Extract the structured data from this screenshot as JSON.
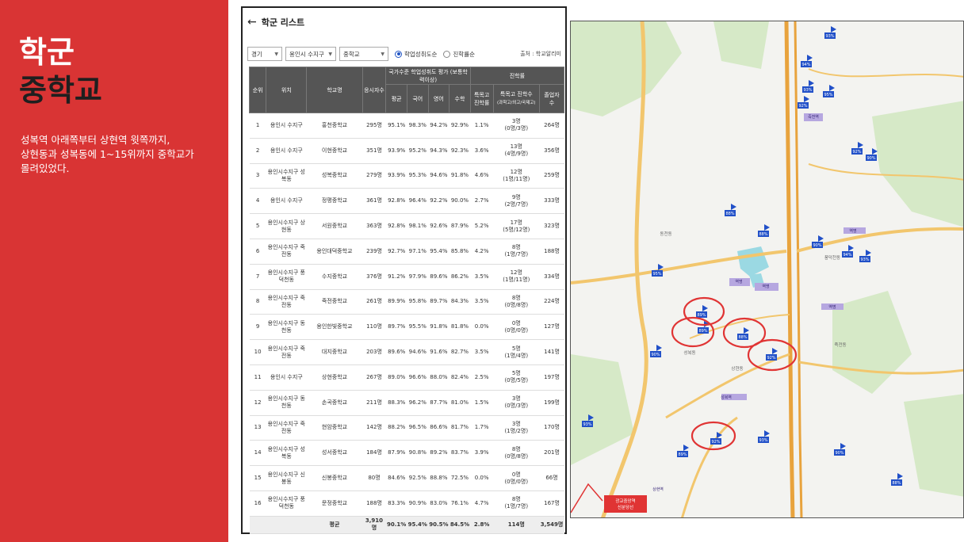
{
  "slide": {
    "title_line1": "학군",
    "title_line2": "중학교",
    "description": "성복역 아래쪽부터 상현역 윗쪽까지,\n상현동과 성복동에 1~15위까지 중학교가\n몰려있었다."
  },
  "list": {
    "header_title": "학군 리스트",
    "filters": {
      "region": "경기",
      "district": "용인시 수지구",
      "school_level": "중학교",
      "sort_option_1": "학업성취도순",
      "sort_option_2": "진학률순",
      "selected_sort": "학업성취도순"
    },
    "source": "출처 : 학교알리미",
    "columns": {
      "rank": "순위",
      "location": "위치",
      "school": "학교명",
      "test_takers": "응시자수",
      "achievement_group": "국가수준 학업성취도 평가 (보통학력이상)",
      "avg": "평균",
      "korean": "국어",
      "english": "영어",
      "math": "수학",
      "advancement_group": "진학률",
      "special_rate": "특목고 진학률",
      "special_count": "특목고 진학수",
      "special_count_sub": "(과학고/외고/국제고)",
      "graduates": "졸업자 수"
    },
    "rows": [
      {
        "rank": "1",
        "location": "용인시 수지구",
        "school": "홍천중학교",
        "takers": "295명",
        "avg": "95.1%",
        "kor": "98.3%",
        "eng": "94.2%",
        "math": "92.9%",
        "rate": "1.1%",
        "count": "3명",
        "count_sub": "(0명/3명)",
        "grads": "264명"
      },
      {
        "rank": "2",
        "location": "용인시 수지구",
        "school": "이현중학교",
        "takers": "351명",
        "avg": "93.9%",
        "kor": "95.2%",
        "eng": "94.3%",
        "math": "92.3%",
        "rate": "3.6%",
        "count": "13명",
        "count_sub": "(4명/9명)",
        "grads": "356명"
      },
      {
        "rank": "3",
        "location": "용인시수지구 성복동",
        "school": "성복중학교",
        "takers": "279명",
        "avg": "93.9%",
        "kor": "95.3%",
        "eng": "94.6%",
        "math": "91.8%",
        "rate": "4.6%",
        "count": "12명",
        "count_sub": "(1명/11명)",
        "grads": "259명"
      },
      {
        "rank": "4",
        "location": "용인시 수지구",
        "school": "정평중학교",
        "takers": "361명",
        "avg": "92.8%",
        "kor": "96.4%",
        "eng": "92.2%",
        "math": "90.0%",
        "rate": "2.7%",
        "count": "9명",
        "count_sub": "(2명/7명)",
        "grads": "333명"
      },
      {
        "rank": "5",
        "location": "용인시수지구 상현동",
        "school": "서원중학교",
        "takers": "363명",
        "avg": "92.8%",
        "kor": "98.1%",
        "eng": "92.6%",
        "math": "87.9%",
        "rate": "5.2%",
        "count": "17명",
        "count_sub": "(5명/12명)",
        "grads": "323명"
      },
      {
        "rank": "6",
        "location": "용인시수지구 죽전동",
        "school": "용인대덕중학교",
        "takers": "239명",
        "avg": "92.7%",
        "kor": "97.1%",
        "eng": "95.4%",
        "math": "85.8%",
        "rate": "4.2%",
        "count": "8명",
        "count_sub": "(1명/7명)",
        "grads": "188명"
      },
      {
        "rank": "7",
        "location": "용인시수지구 풍덕천동",
        "school": "수지중학교",
        "takers": "376명",
        "avg": "91.2%",
        "kor": "97.9%",
        "eng": "89.6%",
        "math": "86.2%",
        "rate": "3.5%",
        "count": "12명",
        "count_sub": "(1명/11명)",
        "grads": "334명"
      },
      {
        "rank": "8",
        "location": "용인시수지구 죽전동",
        "school": "죽전중학교",
        "takers": "261명",
        "avg": "89.9%",
        "kor": "95.8%",
        "eng": "89.7%",
        "math": "84.3%",
        "rate": "3.5%",
        "count": "8명",
        "count_sub": "(0명/8명)",
        "grads": "224명"
      },
      {
        "rank": "9",
        "location": "용인시수지구 동천동",
        "school": "용인한빛중학교",
        "takers": "110명",
        "avg": "89.7%",
        "kor": "95.5%",
        "eng": "91.8%",
        "math": "81.8%",
        "rate": "0.0%",
        "count": "0명",
        "count_sub": "(0명/0명)",
        "grads": "127명"
      },
      {
        "rank": "10",
        "location": "용인시수지구 죽전동",
        "school": "대지중학교",
        "takers": "203명",
        "avg": "89.6%",
        "kor": "94.6%",
        "eng": "91.6%",
        "math": "82.7%",
        "rate": "3.5%",
        "count": "5명",
        "count_sub": "(1명/4명)",
        "grads": "141명"
      },
      {
        "rank": "11",
        "location": "용인시 수지구",
        "school": "상현중학교",
        "takers": "267명",
        "avg": "89.0%",
        "kor": "96.6%",
        "eng": "88.0%",
        "math": "82.4%",
        "rate": "2.5%",
        "count": "5명",
        "count_sub": "(0명/5명)",
        "grads": "197명"
      },
      {
        "rank": "12",
        "location": "용인시수지구 동천동",
        "school": "손곡중학교",
        "takers": "211명",
        "avg": "88.3%",
        "kor": "96.2%",
        "eng": "87.7%",
        "math": "81.0%",
        "rate": "1.5%",
        "count": "3명",
        "count_sub": "(0명/3명)",
        "grads": "199명"
      },
      {
        "rank": "13",
        "location": "용인시수지구 죽전동",
        "school": "현암중학교",
        "takers": "142명",
        "avg": "88.2%",
        "kor": "96.5%",
        "eng": "86.6%",
        "math": "81.7%",
        "rate": "1.7%",
        "count": "3명",
        "count_sub": "(1명/2명)",
        "grads": "170명"
      },
      {
        "rank": "14",
        "location": "용인시수지구 성복동",
        "school": "성서중학교",
        "takers": "184명",
        "avg": "87.9%",
        "kor": "90.8%",
        "eng": "89.2%",
        "math": "83.7%",
        "rate": "3.9%",
        "count": "8명",
        "count_sub": "(0명/8명)",
        "grads": "201명"
      },
      {
        "rank": "15",
        "location": "용인시수지구 신봉동",
        "school": "신봉중학교",
        "takers": "80명",
        "avg": "84.6%",
        "kor": "92.5%",
        "eng": "88.8%",
        "math": "72.5%",
        "rate": "0.0%",
        "count": "0명",
        "count_sub": "(0명/0명)",
        "grads": "66명"
      },
      {
        "rank": "16",
        "location": "용인시수지구 풍덕천동",
        "school": "문정중학교",
        "takers": "188명",
        "avg": "83.3%",
        "kor": "90.9%",
        "eng": "83.0%",
        "math": "76.1%",
        "rate": "4.7%",
        "count": "8명",
        "count_sub": "(1명/7명)",
        "grads": "167명"
      }
    ],
    "average_row": {
      "label": "평균",
      "takers": "3,910명",
      "avg": "90.1%",
      "kor": "95.4%",
      "eng": "90.5%",
      "math": "84.5%",
      "rate": "2.8%",
      "count": "114명",
      "grads": "3,549명"
    }
  },
  "map": {
    "colors": {
      "road": "#f2c66d",
      "highway": "#e8a33d",
      "green": "#d6e9c7",
      "water": "#9bd9e3",
      "marker": "#2150c8",
      "circle": "#e03434"
    },
    "pins": [
      "93%",
      "94%",
      "93%",
      "95%",
      "92%",
      "92%",
      "90%",
      "88%",
      "88%",
      "90%",
      "94%",
      "93%",
      "95%",
      "89%",
      "89%",
      "88%",
      "92%",
      "90%",
      "92%",
      "93%",
      "93%",
      "89%",
      "90%",
      "88%"
    ],
    "station_labels": [
      "죽전역 ",
      "역명 ",
      "역명 ",
      "역명",
      "역명 ",
      "성복역 ",
      "상현역"
    ],
    "area_labels": [
      "성복동",
      "상현동",
      "풍덕천동",
      "죽전동",
      "동천동"
    ],
    "bottom_label_1": "광교중앙역",
    "bottom_label_2": "신분당선"
  }
}
